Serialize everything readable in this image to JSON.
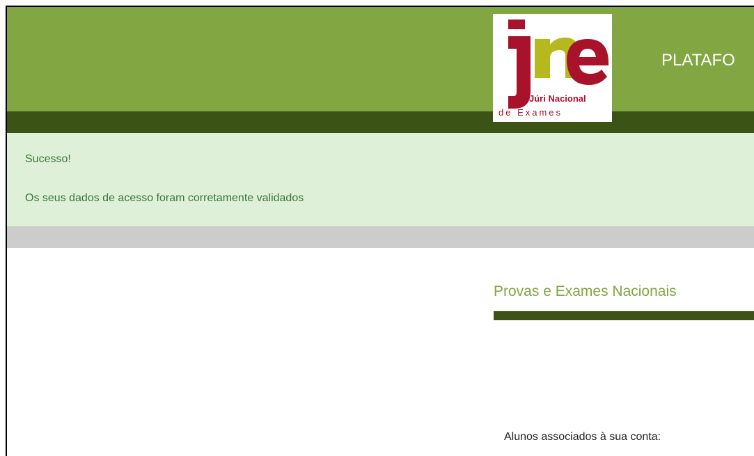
{
  "header": {
    "title": "PLATAFO",
    "logo": {
      "initials": "jne",
      "line1": "Júri Nacional",
      "line2": "de Exames"
    }
  },
  "alert": {
    "title": "Sucesso!",
    "message": "Os seus dados de acesso foram corretamente validados"
  },
  "main": {
    "section_title": "Provas e Exames Nacionais",
    "students_label": "Alunos associados à sua conta:"
  },
  "colors": {
    "header_green": "#82a641",
    "dark_green": "#3b5416",
    "alert_bg": "#dff0d8",
    "alert_text": "#3c763d",
    "logo_red": "#a8122a",
    "logo_olive": "#b6b91d"
  }
}
